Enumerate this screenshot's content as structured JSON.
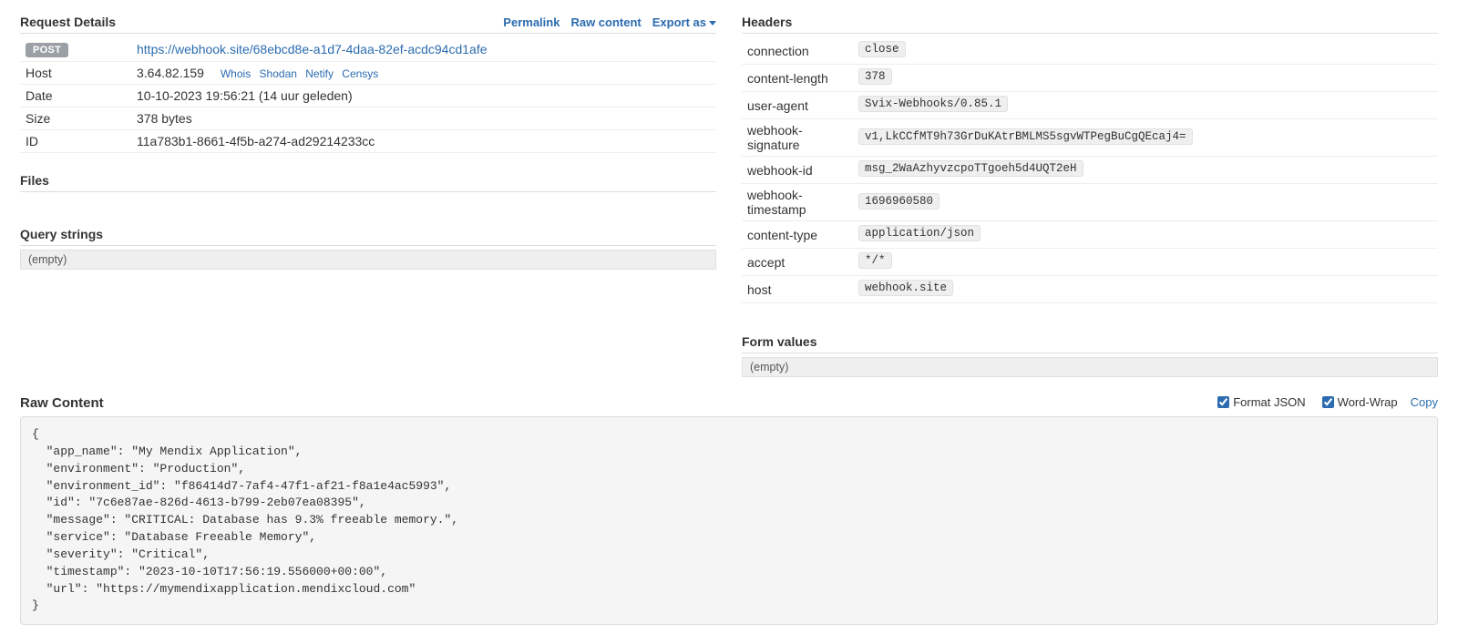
{
  "request_details": {
    "title": "Request Details",
    "actions": {
      "permalink": "Permalink",
      "raw_content": "Raw content",
      "export_as": "Export as"
    },
    "method_badge": "POST",
    "url": "https://webhook.site/68ebcd8e-a1d7-4daa-82ef-acdc94cd1afe",
    "host_label": "Host",
    "host_value": "3.64.82.159",
    "host_links": {
      "whois": "Whois",
      "shodan": "Shodan",
      "netify": "Netify",
      "censys": "Censys"
    },
    "date_label": "Date",
    "date_value": "10-10-2023 19:56:21 (14 uur geleden)",
    "size_label": "Size",
    "size_value": "378 bytes",
    "id_label": "ID",
    "id_value": "11a783b1-8661-4f5b-a274-ad29214233cc"
  },
  "files": {
    "title": "Files"
  },
  "headers": {
    "title": "Headers",
    "rows": [
      {
        "k": "connection",
        "v": "close"
      },
      {
        "k": "content-length",
        "v": "378"
      },
      {
        "k": "user-agent",
        "v": "Svix-Webhooks/0.85.1"
      },
      {
        "k": "webhook-signature",
        "v": "v1,LkCCfMT9h73GrDuKAtrBMLMS5sgvWTPegBuCgQEcaj4="
      },
      {
        "k": "webhook-id",
        "v": "msg_2WaAzhyvzcpoTTgoeh5d4UQT2eH"
      },
      {
        "k": "webhook-timestamp",
        "v": "1696960580"
      },
      {
        "k": "content-type",
        "v": "application/json"
      },
      {
        "k": "accept",
        "v": "*/*"
      },
      {
        "k": "host",
        "v": "webhook.site"
      }
    ]
  },
  "query_strings": {
    "title": "Query strings",
    "empty": "(empty)"
  },
  "form_values": {
    "title": "Form values",
    "empty": "(empty)"
  },
  "raw": {
    "title": "Raw Content",
    "format_json_label": "Format JSON",
    "word_wrap_label": "Word-Wrap",
    "copy_label": "Copy",
    "content": "{\n  \"app_name\": \"My Mendix Application\",\n  \"environment\": \"Production\",\n  \"environment_id\": \"f86414d7-7af4-47f1-af21-f8a1e4ac5993\",\n  \"id\": \"7c6e87ae-826d-4613-b799-2eb07ea08395\",\n  \"message\": \"CRITICAL: Database has 9.3% freeable memory.\",\n  \"service\": \"Database Freeable Memory\",\n  \"severity\": \"Critical\",\n  \"timestamp\": \"2023-10-10T17:56:19.556000+00:00\",\n  \"url\": \"https://mymendixapplication.mendixcloud.com\"\n}"
  }
}
